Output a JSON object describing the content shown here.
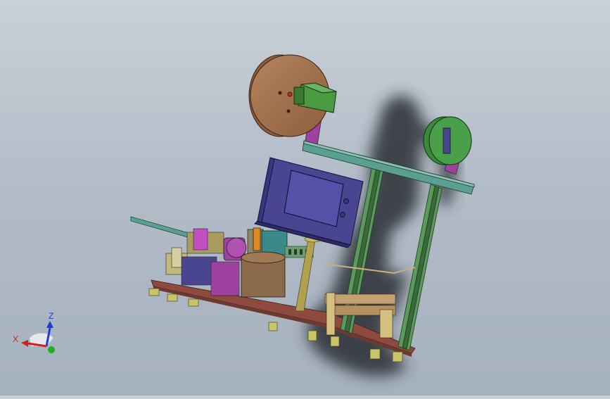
{
  "viewport": {
    "background_top": "#c9d0d8",
    "background_bottom": "#a6b1bf"
  },
  "model": {
    "parts": [
      {
        "name": "spool-large",
        "color": "#a0714c"
      },
      {
        "name": "spool-small",
        "color": "#3a8a3a"
      },
      {
        "name": "control-box",
        "color": "#4a4590"
      },
      {
        "name": "aluminum-frame",
        "color": "#4f8a5a"
      },
      {
        "name": "base-plate",
        "color": "#8a4a3e"
      },
      {
        "name": "motor-block",
        "color": "#3a8a8a"
      },
      {
        "name": "cylinder",
        "color": "#8a6a4a"
      },
      {
        "name": "magenta-bracket",
        "color": "#a040a0"
      },
      {
        "name": "support-rod",
        "color": "#b0a050"
      }
    ]
  },
  "triad": {
    "x_label": "X",
    "z_label": "Z",
    "x_color": "#d0201a",
    "z_color": "#1a3fd0",
    "y_color": "#20b020"
  }
}
